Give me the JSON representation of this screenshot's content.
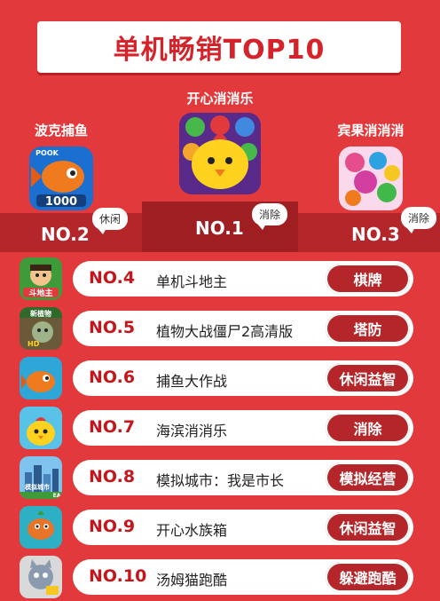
{
  "title": "单机畅销TOP10",
  "top3": [
    {
      "rank": "NO.1",
      "name": "开心消消乐",
      "tag": "消除",
      "icon": "chicken-icon"
    },
    {
      "rank": "NO.2",
      "name": "波克捕鱼",
      "tag": "休闲",
      "icon": "fish-icon"
    },
    {
      "rank": "NO.3",
      "name": "宾果消消消",
      "tag": "消除",
      "icon": "candy-icon"
    }
  ],
  "icon_texts": {
    "pook": "POOK",
    "score_1000": "1000",
    "doudizhu": "斗地主",
    "pvz": "新植物",
    "hd": "HD",
    "city": "模拟城市",
    "ea": "EA"
  },
  "list": [
    {
      "rank": "NO.4",
      "name": "单机斗地主",
      "tag": "棋牌",
      "icon": "landlord-icon"
    },
    {
      "rank": "NO.5",
      "name": "植物大战僵尸2高清版",
      "tag": "塔防",
      "icon": "zombie-icon"
    },
    {
      "rank": "NO.6",
      "name": "捕鱼大作战",
      "tag": "休闲益智",
      "icon": "fish-battle-icon"
    },
    {
      "rank": "NO.7",
      "name": "海滨消消乐",
      "tag": "消除",
      "icon": "beach-chicken-icon"
    },
    {
      "rank": "NO.8",
      "name": "模拟城市：我是市长",
      "tag": "模拟经营",
      "icon": "city-icon"
    },
    {
      "rank": "NO.9",
      "name": "开心水族箱",
      "tag": "休闲益智",
      "icon": "aquarium-icon"
    },
    {
      "rank": "NO.10",
      "name": "汤姆猫跑酷",
      "tag": "躲避跑酷",
      "icon": "tom-cat-icon"
    }
  ],
  "colors": {
    "background": "#e23a3c",
    "accent": "#c4161c",
    "tag": "#b5262a"
  }
}
